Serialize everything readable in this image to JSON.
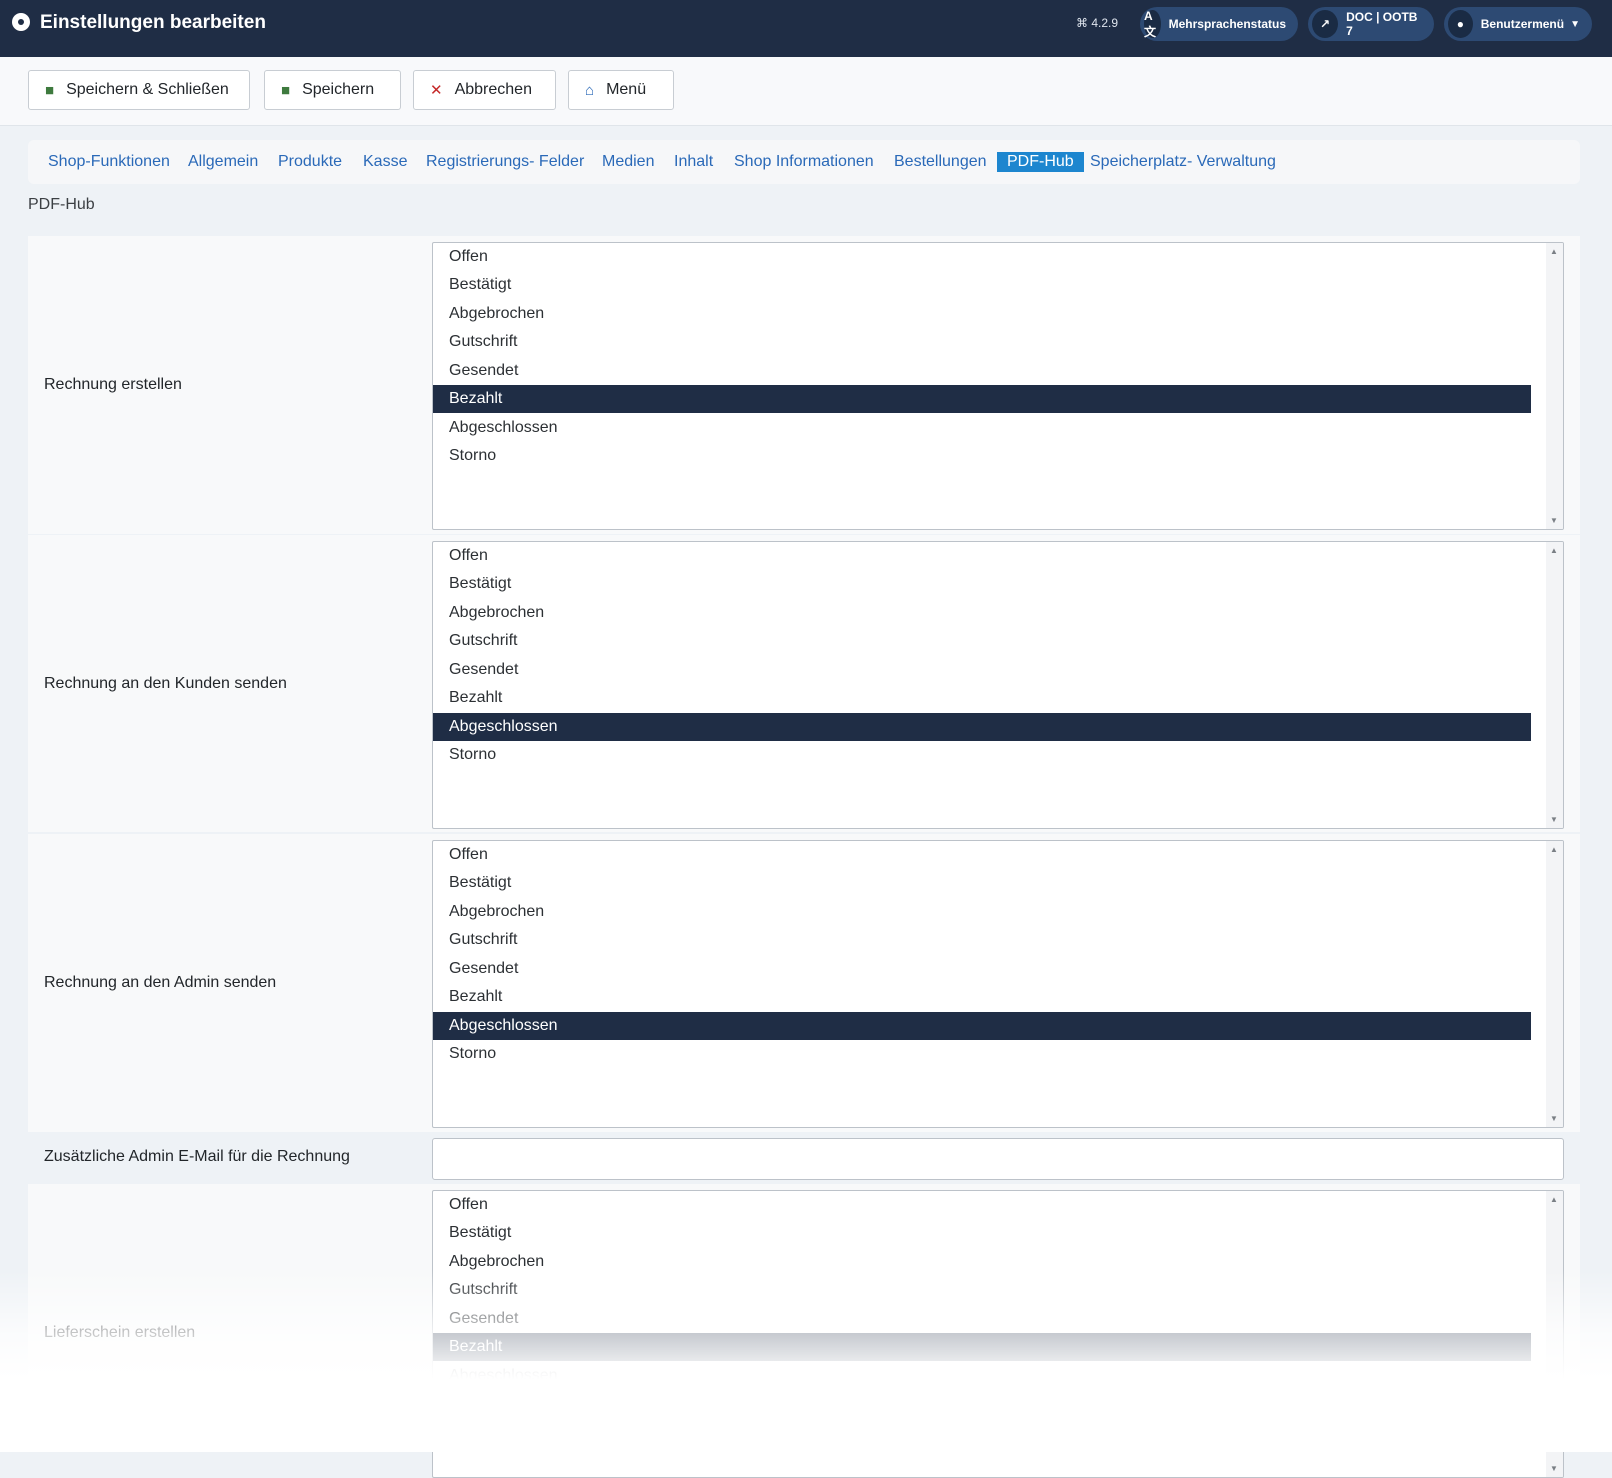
{
  "header": {
    "title": "Einstellungen bearbeiten",
    "version": "4.2.9",
    "multilang_label": "Mehrsprachenstatus",
    "doc_label": "DOC | OOTB 7",
    "user_menu_label": "Benutzermenü",
    "bg_color": "#1f2d45"
  },
  "toolbar": {
    "save_close_label": "Speichern & Schließen",
    "save_label": "Speichern",
    "cancel_label": "Abbrechen",
    "menu_label": "Menü"
  },
  "tabs": [
    {
      "label": "Shop-Funktionen"
    },
    {
      "label": "Allgemein"
    },
    {
      "label": "Produkte"
    },
    {
      "label": "Kasse"
    },
    {
      "label": "Registrierungs- Felder"
    },
    {
      "label": "Medien"
    },
    {
      "label": "Inhalt"
    },
    {
      "label": "Shop Informationen"
    },
    {
      "label": "Bestellungen"
    },
    {
      "label": "PDF-Hub",
      "active": true
    },
    {
      "label": "Speicherplatz- Verwaltung"
    }
  ],
  "active_tab_color": "#1d86cf",
  "section_title": "PDF-Hub",
  "status_options": [
    "Offen",
    "Bestätigt",
    "Abgebrochen",
    "Gutschrift",
    "Gesendet",
    "Bezahlt",
    "Abgeschlossen",
    "Storno"
  ],
  "fields": {
    "invoice_create": {
      "label": "Rechnung erstellen",
      "selected": "Bezahlt"
    },
    "invoice_customer": {
      "label": "Rechnung an den Kunden senden",
      "selected": "Abgeschlossen"
    },
    "invoice_admin": {
      "label": "Rechnung an den Admin senden",
      "selected": "Abgeschlossen"
    },
    "extra_admin_email": {
      "label": "Zusätzliche Admin E-Mail für die Rechnung",
      "value": ""
    },
    "delivery_note": {
      "label": "Lieferschein erstellen",
      "selected": "Bezahlt"
    }
  }
}
